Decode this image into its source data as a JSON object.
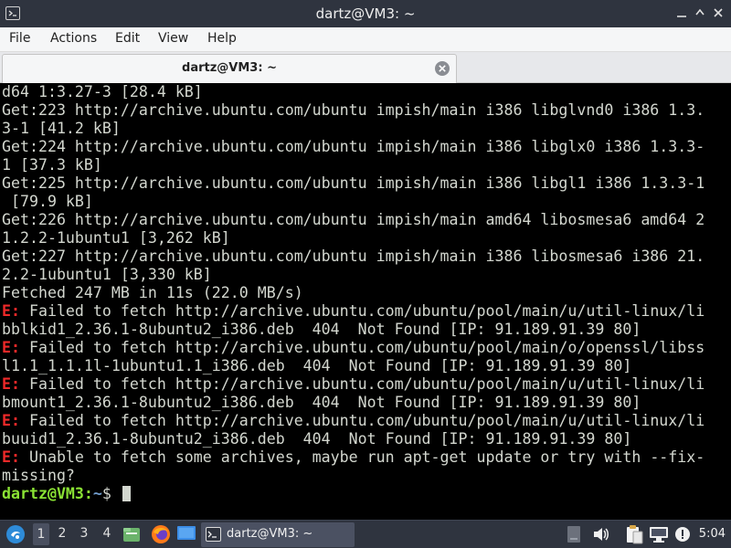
{
  "window": {
    "title": "dartz@VM3: ~"
  },
  "menubar": {
    "file": "File",
    "actions": "Actions",
    "edit": "Edit",
    "view": "View",
    "help": "Help"
  },
  "tab": {
    "label": "dartz@VM3: ~"
  },
  "terminal": {
    "lines": [
      "d64 1:3.27-3 [28.4 kB]",
      "Get:223 http://archive.ubuntu.com/ubuntu impish/main i386 libglvnd0 i386 1.3.",
      "3-1 [41.2 kB]",
      "Get:224 http://archive.ubuntu.com/ubuntu impish/main i386 libglx0 i386 1.3.3-",
      "1 [37.3 kB]",
      "Get:225 http://archive.ubuntu.com/ubuntu impish/main i386 libgl1 i386 1.3.3-1",
      " [79.9 kB]",
      "Get:226 http://archive.ubuntu.com/ubuntu impish/main amd64 libosmesa6 amd64 2",
      "1.2.2-1ubuntu1 [3,262 kB]",
      "Get:227 http://archive.ubuntu.com/ubuntu impish/main i386 libosmesa6 i386 21.",
      "2.2-1ubuntu1 [3,330 kB]",
      "Fetched 247 MB in 11s (22.0 MB/s)"
    ],
    "error_marker": "E:",
    "error_lines": [
      {
        "first": " Failed to fetch http://archive.ubuntu.com/ubuntu/pool/main/u/util-linux/li",
        "second": "bblkid1_2.36.1-8ubuntu2_i386.deb  404  Not Found [IP: 91.189.91.39 80]"
      },
      {
        "first": " Failed to fetch http://archive.ubuntu.com/ubuntu/pool/main/o/openssl/libss",
        "second": "l1.1_1.1.1l-1ubuntu1.1_i386.deb  404  Not Found [IP: 91.189.91.39 80]"
      },
      {
        "first": " Failed to fetch http://archive.ubuntu.com/ubuntu/pool/main/u/util-linux/li",
        "second": "bmount1_2.36.1-8ubuntu2_i386.deb  404  Not Found [IP: 91.189.91.39 80]"
      },
      {
        "first": " Failed to fetch http://archive.ubuntu.com/ubuntu/pool/main/u/util-linux/li",
        "second": "buuid1_2.36.1-8ubuntu2_i386.deb  404  Not Found [IP: 91.189.91.39 80]"
      },
      {
        "first": " Unable to fetch some archives, maybe run apt-get update or try with --fix-",
        "second": "missing?"
      }
    ],
    "prompt": {
      "user_host": "dartz@VM3",
      "colon": ":",
      "path": "~",
      "symbol": "$ "
    }
  },
  "taskbar": {
    "workspaces": [
      "1",
      "2",
      "3",
      "4"
    ],
    "active_workspace": "1",
    "task_label": "dartz@VM3: ~",
    "clock": "5:04",
    "icons": [
      "start-menu-icon",
      "file-manager-icon",
      "firefox-icon",
      "desktop-icon",
      "terminal-icon",
      "volume-icon",
      "clipboard-icon",
      "network-icon",
      "notification-icon"
    ]
  },
  "colors": {
    "terminal_bg": "#000000",
    "terminal_fg": "#d3d7cf",
    "error_red": "#ef2929",
    "prompt_green": "#8ae234",
    "prompt_blue": "#729fcf",
    "titlebar_bg": "#2f343f"
  }
}
